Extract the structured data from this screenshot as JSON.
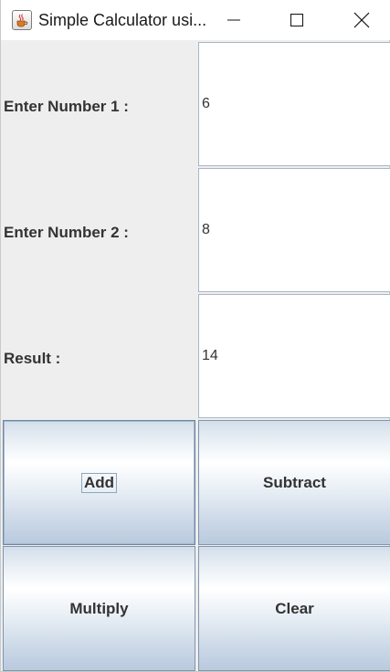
{
  "window": {
    "title": "Simple Calculator usi...",
    "controls": [
      "minimize-icon",
      "maximize-icon",
      "close-icon"
    ]
  },
  "form": {
    "number1": {
      "label": "Enter Number 1 :",
      "value": "6"
    },
    "number2": {
      "label": "Enter Number 2 :",
      "value": "8"
    },
    "result": {
      "label": "Result :",
      "value": "14"
    }
  },
  "buttons": {
    "add": "Add",
    "subtract": "Subtract",
    "multiply": "Multiply",
    "clear": "Clear"
  },
  "colors": {
    "panel_background": "#eeeeee",
    "button_gradient_top": "#d3deea",
    "button_gradient_bottom": "#b9cadd",
    "button_border": "#7f95ad"
  }
}
